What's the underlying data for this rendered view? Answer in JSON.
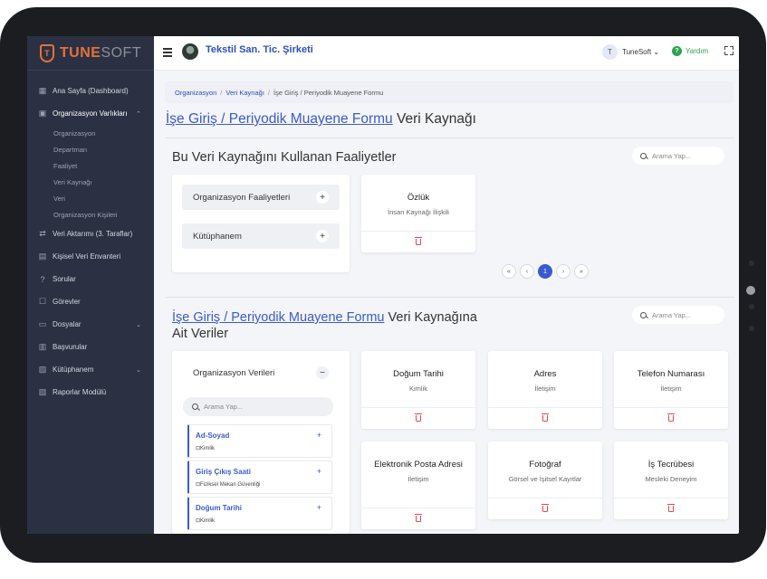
{
  "topbar": {
    "company_name": "Tekstil San. Tic. Şirketi",
    "user_initial": "T",
    "user_name": "TuneSoft",
    "help_label": "Yardım"
  },
  "logo": {
    "mark": "T",
    "text_bold": "TUNE",
    "text_light": "SOFT"
  },
  "sidebar": {
    "items": [
      {
        "label": "Ana Sayfa (Dashboard)",
        "icon": "dashboard-icon"
      },
      {
        "label": "Organizasyon Varlıkları",
        "icon": "assets-icon",
        "expanded": true
      },
      {
        "label": "Veri Aktarımı (3. Taraflar)",
        "icon": "transfer-icon"
      },
      {
        "label": "Kişisel Veri Envanteri",
        "icon": "table-icon"
      },
      {
        "label": "Sorular",
        "icon": "question-icon"
      },
      {
        "label": "Görevler",
        "icon": "tasks-icon"
      },
      {
        "label": "Dosyalar",
        "icon": "folder-icon"
      },
      {
        "label": "Başvurular",
        "icon": "applications-icon"
      },
      {
        "label": "Kütüphanem",
        "icon": "library-icon"
      },
      {
        "label": "Raporlar Modülü",
        "icon": "reports-icon"
      }
    ],
    "sub_items": [
      "Organizasyon",
      "Departman",
      "Faaliyet",
      "Veri Kaynağı",
      "Veri",
      "Organizasyon Kişileri"
    ]
  },
  "breadcrumb": {
    "items": [
      "Organizasyon",
      "Veri Kaynağı",
      "İşe Giriş / Periyodik Muayene Formu"
    ]
  },
  "page": {
    "title_link": "İşe Giriş / Periyodik Muayene Formu",
    "title_rest": "Veri Kaynağı"
  },
  "section1": {
    "title": "Bu Veri Kaynağını Kullanan Faaliyetler",
    "search_placeholder": "Arama Yap...",
    "accordions": [
      "Organizasyon Faaliyetleri",
      "Kütüphanem"
    ],
    "cards": [
      {
        "title": "Özlük",
        "subtitle": "İnsan Kaynağı İlişkili"
      }
    ],
    "pager": {
      "first": "«",
      "prev": "‹",
      "current": "1",
      "next": "›",
      "last": "»"
    }
  },
  "section2": {
    "title_link": "İşe Giriş / Periyodik Muayene Formu",
    "title_rest": "Veri Kaynağına",
    "title_line2": "Ait Veriler",
    "search_placeholder": "Arama Yap...",
    "panel_title": "Organizasyon Verileri",
    "panel_search_placeholder": "Arama Yap...",
    "data_items": [
      {
        "name": "Ad-Soyad",
        "category": "Kimlik"
      },
      {
        "name": "Giriş Çıkış Saati",
        "category": "Fiziksel Mekan Güvenliği"
      },
      {
        "name": "Doğum Tarihi",
        "category": "Kimlik"
      }
    ],
    "cards": [
      {
        "title": "Doğum Tarihi",
        "subtitle": "Kimlik"
      },
      {
        "title": "Adres",
        "subtitle": "İletişim"
      },
      {
        "title": "Telefon Numarası",
        "subtitle": "İletişim"
      },
      {
        "title": "Elektronik Posta Adresi",
        "subtitle": "İletişim"
      },
      {
        "title": "Fotoğraf",
        "subtitle": "Görsel ve İşitsel Kayıtlar"
      },
      {
        "title": "İş Tecrübesi",
        "subtitle": "Mesleki Deneyim"
      }
    ]
  },
  "colors": {
    "sidebar": "#2b3143",
    "accent": "#3a5bd0",
    "brand": "#e2733a",
    "danger": "#e34848",
    "help": "#2aa44f"
  }
}
